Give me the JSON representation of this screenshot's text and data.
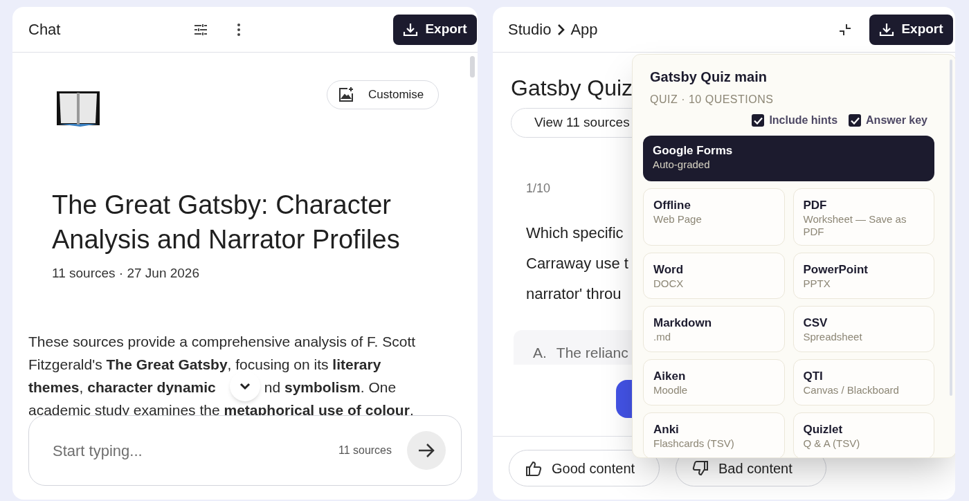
{
  "chat_panel": {
    "title": "Chat",
    "export_button": "Export",
    "customise_button": "Customise",
    "heading": "The Great Gatsby: Character Analysis and Narrator Profiles",
    "meta": "11 sources · 27 Jun 2026",
    "summary_lines": [
      {
        "parts": [
          "These sources provide a comprehensive analysis of F. Scott"
        ]
      },
      {
        "parts": [
          "Fitzgerald's **The Great Gatsby**, focusing on its **literary**"
        ]
      },
      {
        "parts": [
          "**themes**, **character dynamic**",
          "nd **symbolism**. One"
        ]
      },
      {
        "parts": [
          "academic study examines the **metaphorical use of colour**."
        ]
      }
    ],
    "composer": {
      "placeholder": "Start typing...",
      "source_count": "11 sources"
    }
  },
  "studio_panel": {
    "breadcrumb": [
      "Studio",
      "App"
    ],
    "export_button": "Export",
    "quiz_title": "Gatsby Quiz",
    "sources_button": "View 11 sources",
    "progress": "1/10",
    "question_lines": [
      "Which specific",
      "Carraway use t",
      "narrator' throu"
    ],
    "option": {
      "letter": "A.",
      "text": "The relianc"
    },
    "feedback": [
      {
        "kind": "good",
        "label": "Good content"
      },
      {
        "kind": "bad",
        "label": "Bad content"
      }
    ]
  },
  "export_menu": {
    "title": "Gatsby Quiz main",
    "subtitle": "QUIZ · 10 QUESTIONS",
    "options": [
      {
        "label": "Include hints",
        "checked": true
      },
      {
        "label": "Answer key",
        "checked": true
      }
    ],
    "formats": [
      {
        "name": "Google Forms",
        "detail": "Auto-graded",
        "selected": true
      },
      {
        "name": "Offline",
        "detail": "Web Page",
        "selected": false
      },
      {
        "name": "PDF",
        "detail": "Worksheet — Save as PDF",
        "selected": false
      },
      {
        "name": "Word",
        "detail": "DOCX",
        "selected": false
      },
      {
        "name": "PowerPoint",
        "detail": "PPTX",
        "selected": false
      },
      {
        "name": "Markdown",
        "detail": ".md",
        "selected": false
      },
      {
        "name": "CSV",
        "detail": "Spreadsheet",
        "selected": false
      },
      {
        "name": "Aiken",
        "detail": "Moodle",
        "selected": false
      },
      {
        "name": "QTI",
        "detail": "Canvas / Blackboard",
        "selected": false
      },
      {
        "name": "Anki",
        "detail": "Flashcards (TSV)",
        "selected": false
      },
      {
        "name": "Quizlet",
        "detail": "Q & A (TSV)",
        "selected": false
      }
    ]
  }
}
